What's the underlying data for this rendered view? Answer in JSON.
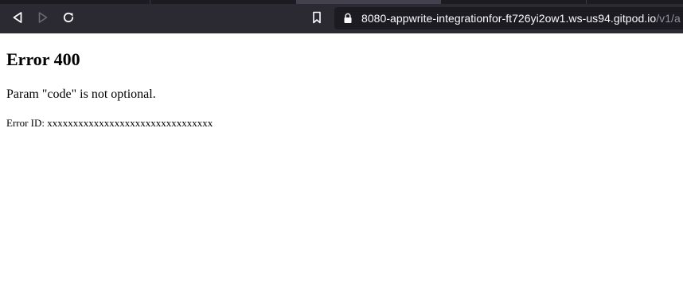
{
  "browser": {
    "url_host": "8080-appwrite-integrationfor-ft726yi2ow1.ws-us94.gitpod.io",
    "url_path": "/v1/a",
    "icons": {
      "back": "back-arrow-icon",
      "forward": "forward-arrow-icon",
      "reload": "reload-icon",
      "bookmark": "bookmark-icon",
      "lock": "lock-icon"
    },
    "colors": {
      "toolbar": "#2b2a33",
      "urlbar": "#1c1b22",
      "icon": "#fbfbfe",
      "disabled_icon": "#6b6a73"
    }
  },
  "page": {
    "heading": "Error 400",
    "message": "Param \"code\" is not optional.",
    "error_id_label": "Error ID: xxxxxxxxxxxxxxxxxxxxxxxxxxxxxxxx"
  }
}
